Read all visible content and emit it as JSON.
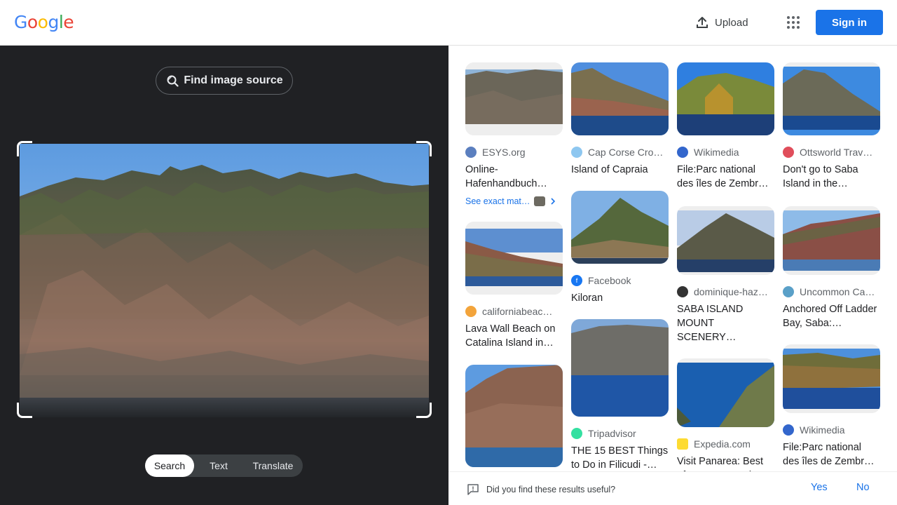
{
  "header": {
    "logo_letters": [
      "G",
      "o",
      "o",
      "g",
      "l",
      "e"
    ],
    "logo_colors": [
      "#4285F4",
      "#EA4335",
      "#FBBC05",
      "#4285F4",
      "#34A853",
      "#EA4335"
    ],
    "upload_label": "Upload",
    "apps_icon": "apps-grid-icon",
    "signin_label": "Sign in"
  },
  "left_pane": {
    "find_source_label": "Find image source",
    "modes": [
      "Search",
      "Text",
      "Translate"
    ],
    "active_mode": "Search"
  },
  "results": {
    "col1": [
      {
        "source": "ESYS.org",
        "title": "Online-Hafenhandbuch…",
        "exact": "See exact mat…",
        "fav_color": "#5b7fbf",
        "img": "c1a"
      },
      {
        "source": "californiabeac…",
        "title": "Lava Wall Beach on Catalina Island in…",
        "fav_color": "#f3a43b",
        "img": "c1b"
      },
      {
        "img": "c1c"
      }
    ],
    "col2": [
      {
        "source": "Cap Corse Cro…",
        "title": "Island of Capraia",
        "fav_color": "#8ec7f0",
        "img": "c2a"
      },
      {
        "source": "Facebook",
        "title": "Kiloran",
        "fav_color": "#1877f2",
        "img": "c2b"
      },
      {
        "source": "Tripadvisor",
        "title": "THE 15 BEST Things to Do in Filicudi -…",
        "fav_color": "#34e0a1",
        "img": "c2c"
      }
    ],
    "col3": [
      {
        "source": "Wikimedia",
        "title": "File:Parc national des îles de Zembr…",
        "fav_color": "#3366cc",
        "img": "c3a"
      },
      {
        "source": "dominique-haz…",
        "title": "SABA ISLAND MOUNT SCENERY…",
        "fav_color": "#333333",
        "img": "c3b"
      },
      {
        "source": "Expedia.com",
        "title": "Visit Panarea: Best of Panarea Touris…",
        "fav_color": "#fddb32",
        "img": "c3c"
      }
    ],
    "col4": [
      {
        "source": "Ottsworld Trav…",
        "title": "Don't go to Saba Island in the…",
        "fav_color": "#e04e5b",
        "img": "c4a"
      },
      {
        "source": "Uncommon Ca…",
        "title": "Anchored Off Ladder Bay, Saba:…",
        "fav_color": "#5aa0c8",
        "img": "c4b"
      },
      {
        "source": "Wikimedia",
        "title": "File:Parc national des îles de Zembr…",
        "fav_color": "#3366cc",
        "img": "c4c"
      }
    ]
  },
  "feedback": {
    "question": "Did you find these results useful?",
    "yes": "Yes",
    "no": "No"
  }
}
